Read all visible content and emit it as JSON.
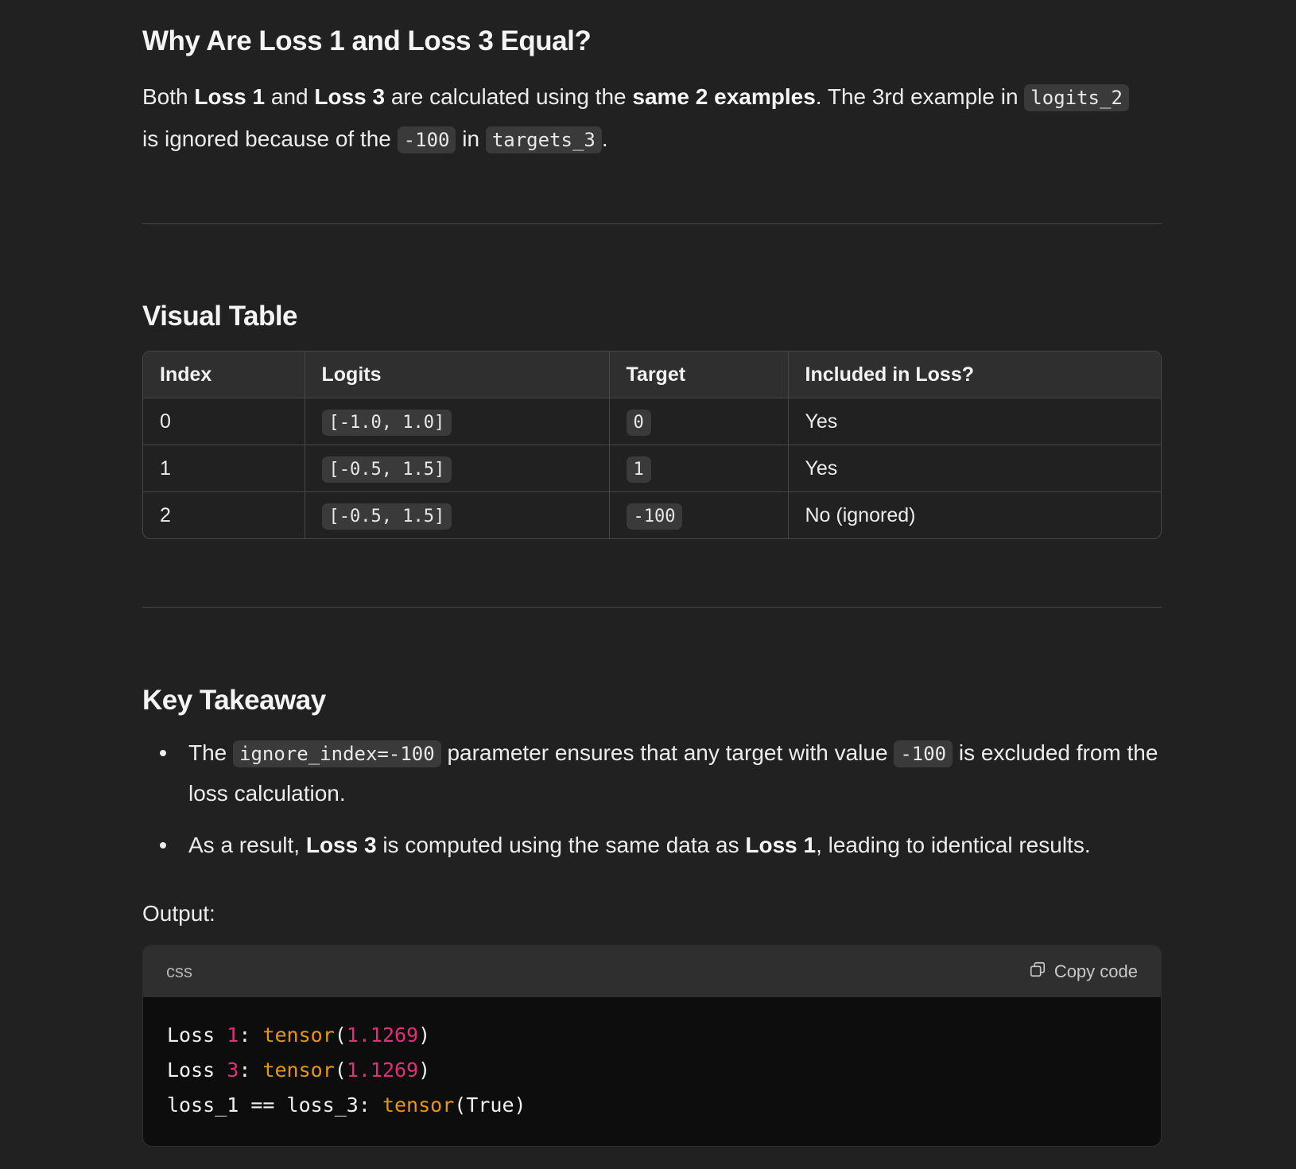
{
  "section_why": {
    "heading": "Why Are Loss 1 and Loss 3 Equal?",
    "p_both": "Both ",
    "loss1": "Loss 1",
    "p_and": " and ",
    "loss3": "Loss 3",
    "p_calc": " are calculated using the ",
    "same2": "same 2 examples",
    "p_third": ". The 3rd example in ",
    "code_logits2": "logits_2",
    "p_ignored": " is ignored because of the ",
    "code_neg100": "-100",
    "p_in": " in ",
    "code_targets3": "targets_3",
    "p_end": "."
  },
  "section_table": {
    "heading": "Visual Table",
    "columns": [
      "Index",
      "Logits",
      "Target",
      "Included in Loss?"
    ],
    "rows": [
      {
        "index": "0",
        "logits": "[-1.0, 1.0]",
        "target": "0",
        "included": "Yes"
      },
      {
        "index": "1",
        "logits": "[-0.5, 1.5]",
        "target": "1",
        "included": "Yes"
      },
      {
        "index": "2",
        "logits": "[-0.5, 1.5]",
        "target": "-100",
        "included": "No (ignored)"
      }
    ]
  },
  "section_key": {
    "heading": "Key Takeaway",
    "b1_the": "The ",
    "b1_code": "ignore_index=-100",
    "b1_mid": " parameter ensures that any target with value ",
    "b1_code2": "-100",
    "b1_end": " is excluded from the loss calculation.",
    "b2_start": "As a result, ",
    "b2_loss3": "Loss 3",
    "b2_mid": " is computed using the same data as ",
    "b2_loss1": "Loss 1",
    "b2_end": ", leading to identical results."
  },
  "output": {
    "label": "Output:",
    "language": "css",
    "copy_label": "Copy code",
    "lines": [
      {
        "a": "Loss ",
        "num": "1",
        "b": ": ",
        "fn": "tensor",
        "c": "(",
        "val": "1.1269",
        "d": ")"
      },
      {
        "a": "Loss ",
        "num": "3",
        "b": ": ",
        "fn": "tensor",
        "c": "(",
        "val": "1.1269",
        "d": ")"
      },
      {
        "a": "loss_1 == loss_3: ",
        "fn": "tensor",
        "c": "(True)"
      }
    ]
  },
  "colors": {
    "background": "#212121",
    "code_number": "#df3079",
    "code_function": "#e9950c"
  }
}
